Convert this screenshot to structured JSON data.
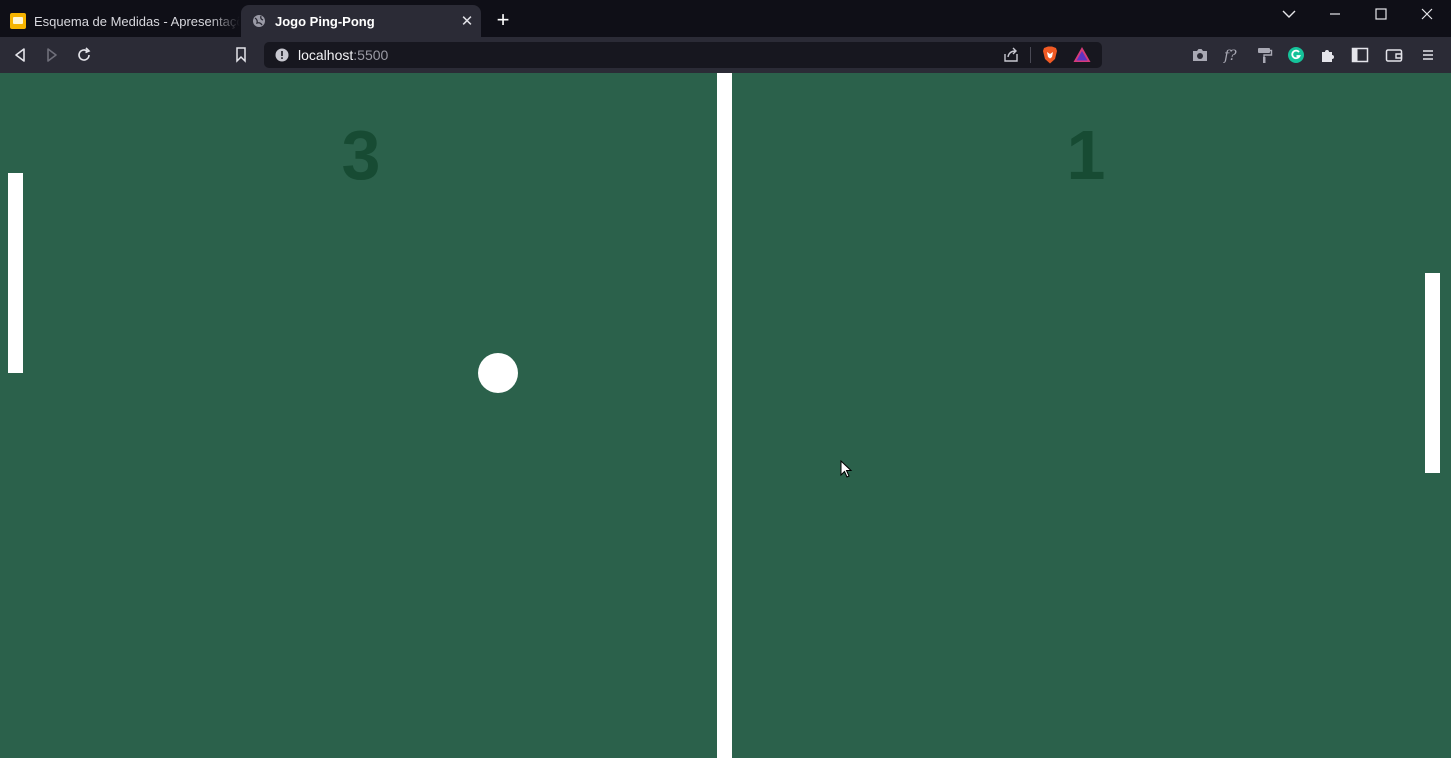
{
  "browser": {
    "tabs": [
      {
        "title": "Esquema de Medidas - Apresentações",
        "icon": "slides-icon",
        "active": false
      },
      {
        "title": "Jogo Ping-Pong",
        "icon": "globe-icon",
        "active": true,
        "close": "✕"
      }
    ],
    "new_tab": "+",
    "address": {
      "host": "localhost",
      "port": ":5500"
    }
  },
  "game": {
    "background": "#2b614b",
    "score_color": "#174b33",
    "player_score": "3",
    "cpu_score": "1"
  }
}
